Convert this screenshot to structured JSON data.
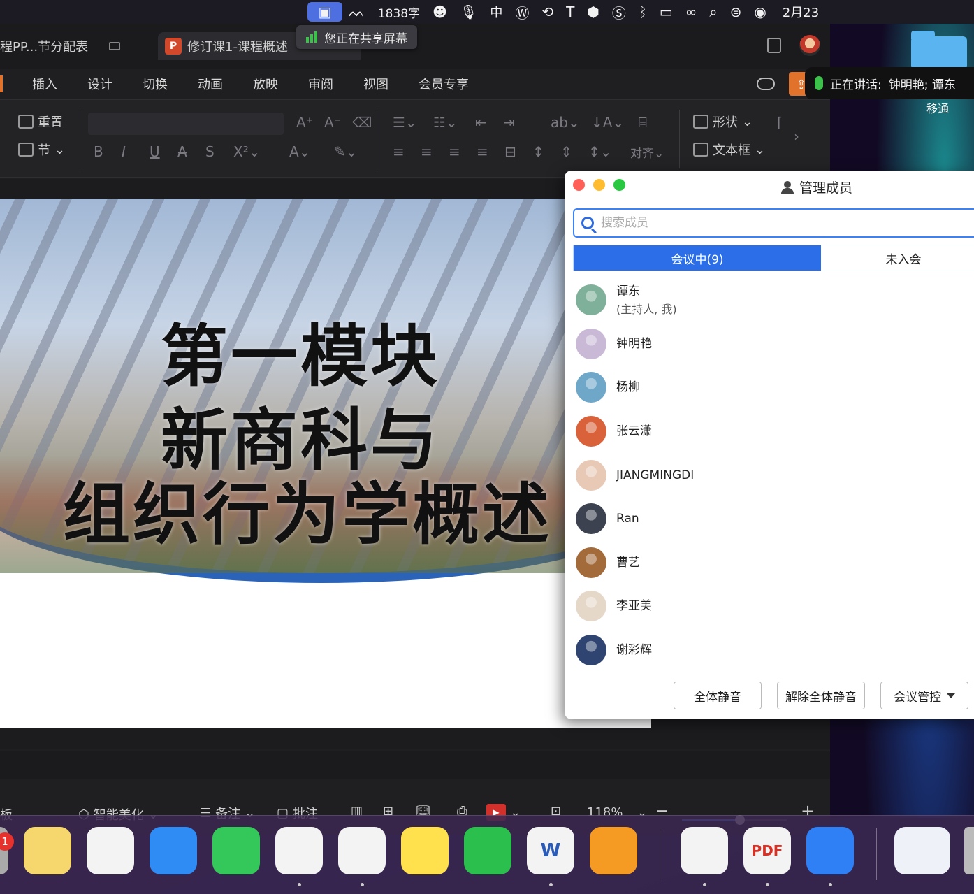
{
  "menubar": {
    "word_count": "1838字",
    "ime": "中",
    "date": "2月23"
  },
  "app": {
    "tabs": [
      {
        "label": "程PP...节分配表"
      },
      {
        "label": "修订课1-课程概述"
      }
    ],
    "share_notice": "您正在共享屏幕",
    "menu": [
      "插入",
      "设计",
      "切换",
      "动画",
      "放映",
      "审阅",
      "视图",
      "会员专享"
    ],
    "share_button": "分",
    "ribbon": {
      "reset": "重置",
      "section": "节",
      "shape": "形状",
      "textbox": "文本框",
      "align": "对齐"
    },
    "slide": {
      "line1": "第一模块",
      "line2": "新商科与",
      "line3": "组织行为学概述"
    },
    "statusbar": {
      "left": "板",
      "beautify": "智能美化",
      "notes": "备注",
      "comment": "批注",
      "zoom": "118%",
      "zoom_fraction": 0.55
    }
  },
  "speaking": {
    "label": "正在讲话:",
    "names": "钟明艳; 谭东"
  },
  "desktop": {
    "folder_label": "移通"
  },
  "panel": {
    "title": "管理成员",
    "search_placeholder": "搜索成员",
    "tab_in_meeting": "会议中(9)",
    "tab_not_joined": "未入会",
    "members": [
      {
        "name": "谭东",
        "sub": "(主持人, 我)",
        "avatar_color": "#7fb09a"
      },
      {
        "name": "钟明艳",
        "sub": "",
        "avatar_color": "#c9b9d6"
      },
      {
        "name": "杨柳",
        "sub": "",
        "avatar_color": "#6fa7c9"
      },
      {
        "name": "张云潇",
        "sub": "",
        "avatar_color": "#d9623b"
      },
      {
        "name": "JIANGMINGDI",
        "sub": "",
        "avatar_color": "#e8c9b5"
      },
      {
        "name": "Ran",
        "sub": "",
        "avatar_color": "#3d4250"
      },
      {
        "name": "曹艺",
        "sub": "",
        "avatar_color": "#a36a3a"
      },
      {
        "name": "李亚美",
        "sub": "",
        "avatar_color": "#e6d8c8"
      },
      {
        "name": "谢彩辉",
        "sub": "",
        "avatar_color": "#2f4470"
      }
    ],
    "mute_all": "全体静音",
    "unmute_all": "解除全体静音",
    "meeting_control": "会议管控"
  },
  "dock": {
    "badge": "1",
    "apps": [
      {
        "name": "notes",
        "color": "#f5d76e"
      },
      {
        "name": "freeform",
        "color": "#f3f3f3"
      },
      {
        "name": "app-store",
        "color": "#2f8cf5"
      },
      {
        "name": "facetime",
        "color": "#34c759"
      },
      {
        "name": "safari",
        "color": "#f3f3f3"
      },
      {
        "name": "chrome",
        "color": "#f3f3f3"
      },
      {
        "name": "qq-music",
        "color": "#ffe14d"
      },
      {
        "name": "wechat",
        "color": "#2bc04d"
      },
      {
        "name": "word",
        "color": "#f3f3f3"
      },
      {
        "name": "books",
        "color": "#f59a23"
      },
      {
        "name": "wps",
        "color": "#f3f3f3"
      },
      {
        "name": "pdf",
        "color": "#f3f3f3"
      },
      {
        "name": "tencent-meeting",
        "color": "#2f7ff5"
      }
    ],
    "word_letter": "W",
    "pdf_label": "PDF"
  }
}
